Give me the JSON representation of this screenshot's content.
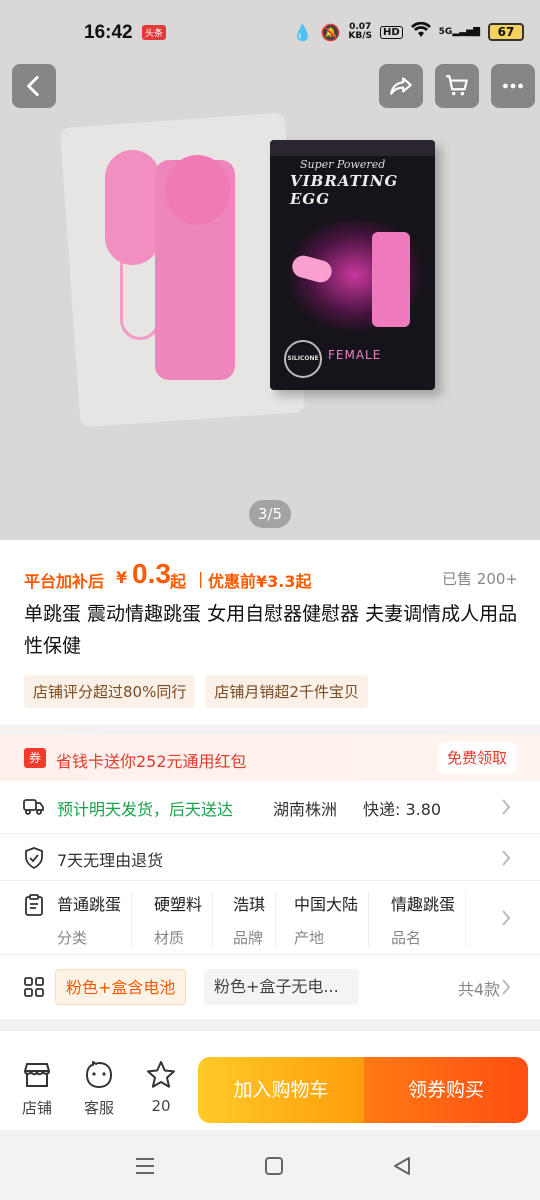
{
  "status_bar": {
    "time": "16:42",
    "badge": "头条",
    "net_speed_value": "0.07",
    "net_speed_unit": "KB/S",
    "hd": "HD",
    "network": "5G",
    "battery": "67"
  },
  "gallery": {
    "counter": "3/5"
  },
  "product_box": {
    "brand_sub": "Super Powered",
    "brand": "VIBRATING EGG",
    "seal": "SILICONE",
    "female": "FEMALE"
  },
  "price": {
    "label": "平台加补后",
    "yen": "¥",
    "value": "0.3",
    "suffix": "起",
    "separator": "|",
    "before": "优惠前¥3.3起",
    "sold": "已售 200+"
  },
  "title": "单跳蛋 震动情趣跳蛋 女用自慰器健慰器 夫妻调情成人用品性保健",
  "tags": [
    "店铺评分超过80%同行",
    "店铺月销超2千件宝贝"
  ],
  "coupon": {
    "text": "省钱卡送你252元通用红包",
    "button": "免费领取"
  },
  "shipping": {
    "promise": "预计明天发货，后天送达",
    "origin": "湖南株洲",
    "express": "快递: 3.80"
  },
  "returns": {
    "text": "7天无理由退货"
  },
  "attributes": [
    {
      "value": "普通跳蛋",
      "key": "分类"
    },
    {
      "value": "硬塑料",
      "key": "材质"
    },
    {
      "value": "浩琪",
      "key": "品牌"
    },
    {
      "value": "中国大陆",
      "key": "产地"
    },
    {
      "value": "情趣跳蛋",
      "key": "品名"
    }
  ],
  "skus": {
    "selected": "粉色+盒含电池",
    "other": "粉色+盒子无电...",
    "count": "共4款"
  },
  "bottom_bar": {
    "store": "店铺",
    "service": "客服",
    "favorites": "20",
    "add_cart": "加入购物车",
    "buy": "领券购买"
  },
  "colors": {
    "accent": "#ff5a00",
    "green": "#16a34a",
    "coupon_red": "#e23a2a"
  }
}
